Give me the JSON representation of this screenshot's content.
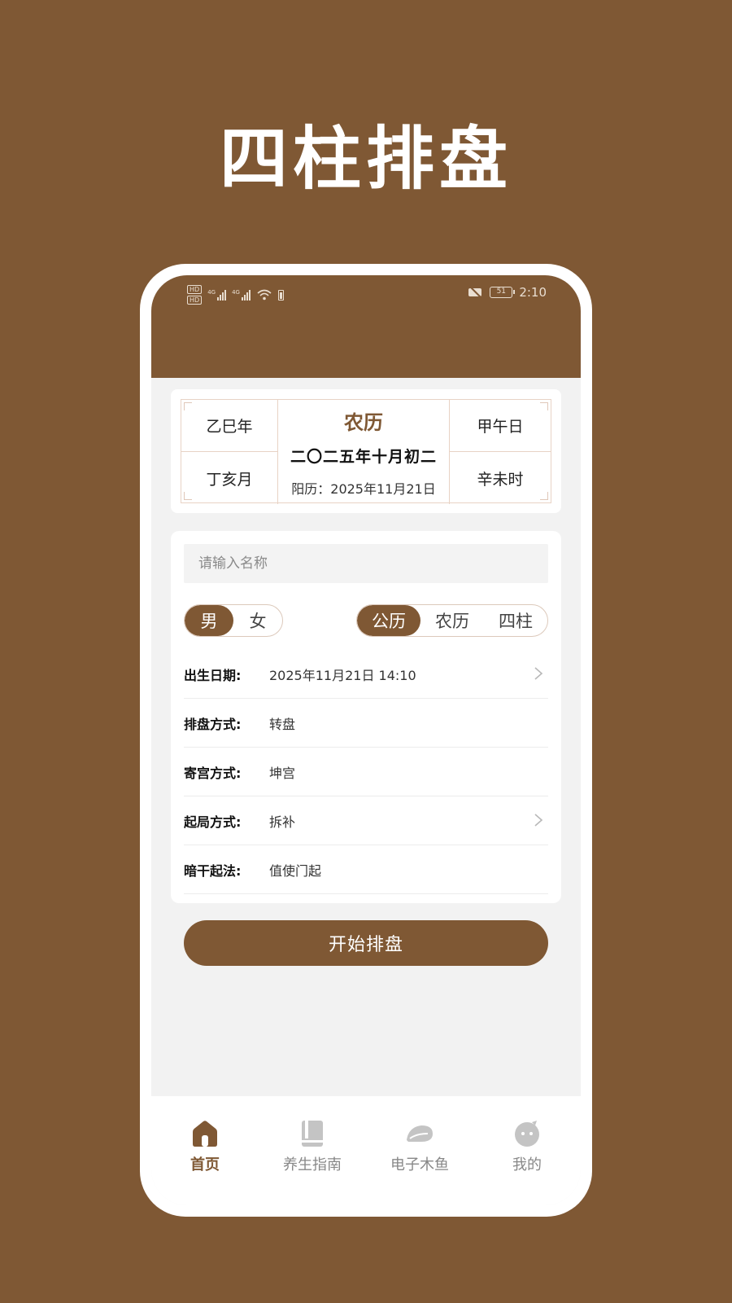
{
  "promo": {
    "title": "四柱排盘"
  },
  "status": {
    "time": "2:10",
    "battery": "51",
    "hd1": "HD",
    "hd2": "HD",
    "net1": "4G",
    "net2": "4G"
  },
  "calendar": {
    "year_gz": "乙巳年",
    "month_gz": "丁亥月",
    "day_gz": "甲午日",
    "hour_gz": "辛未时",
    "lunar_label": "农历",
    "lunar_date": "二〇二五年十月初二",
    "solar_date": "阳历：2025年11月21日"
  },
  "form": {
    "name_placeholder": "请输入名称",
    "gender": {
      "options": [
        "男",
        "女"
      ],
      "selected": "男"
    },
    "calendar_type": {
      "options": [
        "公历",
        "农历",
        "四柱"
      ],
      "selected": "公历"
    },
    "fields": [
      {
        "label": "出生日期:",
        "value": "2025年11月21日 14:10",
        "has_arrow": true
      },
      {
        "label": "排盘方式:",
        "value": "转盘",
        "has_arrow": false
      },
      {
        "label": "寄宫方式:",
        "value": "坤宫",
        "has_arrow": false
      },
      {
        "label": "起局方式:",
        "value": "拆补",
        "has_arrow": true
      },
      {
        "label": "暗干起法:",
        "value": "值使门起",
        "has_arrow": false
      }
    ],
    "submit_label": "开始排盘"
  },
  "tabs": [
    {
      "label": "首页",
      "icon": "home-icon",
      "active": true
    },
    {
      "label": "养生指南",
      "icon": "book-icon",
      "active": false
    },
    {
      "label": "电子木鱼",
      "icon": "wooden-fish-icon",
      "active": false
    },
    {
      "label": "我的",
      "icon": "profile-icon",
      "active": false
    }
  ],
  "colors": {
    "brand": "#7f5834",
    "background": "#f2f2f2",
    "inactive": "#bbbbbb"
  }
}
